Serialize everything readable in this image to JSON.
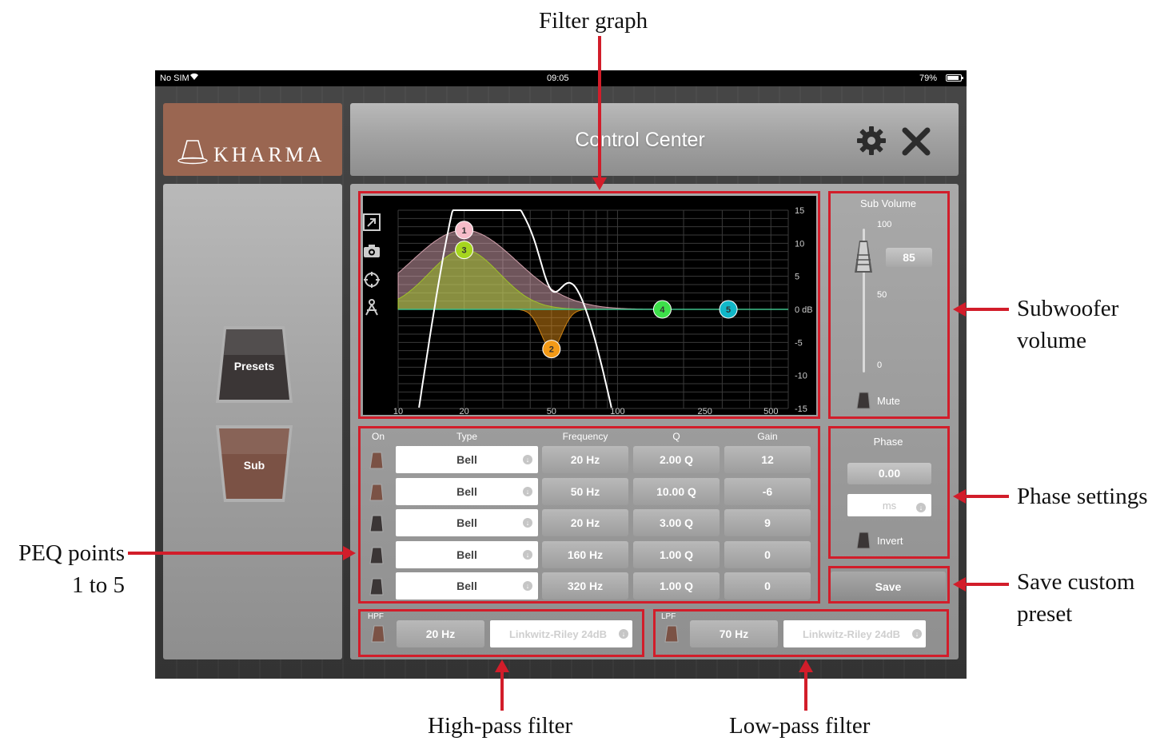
{
  "annotations": {
    "filter_graph": "Filter graph",
    "subwoofer_volume": [
      "Subwoofer",
      "volume"
    ],
    "phase_settings": "Phase settings",
    "save_custom_preset": [
      "Save custom",
      "preset"
    ],
    "peq_points": [
      "PEQ points",
      "1 to 5"
    ],
    "high_pass": "High-pass filter",
    "low_pass": "Low-pass filter",
    "color": "#d21d2a"
  },
  "status_bar": {
    "carrier": "No SIM",
    "time": "09:05",
    "battery": "79%"
  },
  "logo": {
    "text": "KHARMA",
    "color": "#9a6651"
  },
  "header": {
    "title": "Control Center",
    "settings_icon": "gear-icon",
    "close_icon": "close-icon"
  },
  "sidebar": {
    "items": [
      {
        "label": "Presets",
        "color": "#3b3636"
      },
      {
        "label": "Sub",
        "color": "#7b5245"
      }
    ]
  },
  "graph": {
    "tools": [
      "expand-icon",
      "camera-icon",
      "crosshair-icon",
      "compass-icon"
    ],
    "x_ticks": [
      "10",
      "20",
      "50",
      "100",
      "250",
      "500"
    ],
    "y_ticks": [
      "15",
      "10",
      "5",
      "0 dB",
      "-5",
      "-10",
      "-15"
    ],
    "xlim": [
      10,
      600
    ],
    "ylim": [
      -15,
      15
    ],
    "points": [
      {
        "label": "1",
        "freq": 20,
        "gain": 12,
        "q": 2,
        "color": "#f6bcc9"
      },
      {
        "label": "2",
        "freq": 50,
        "gain": -6,
        "q": 10,
        "color": "#f39a17"
      },
      {
        "label": "3",
        "freq": 20,
        "gain": 9,
        "q": 3,
        "color": "#a6d51e"
      },
      {
        "label": "4",
        "freq": 160,
        "gain": 0,
        "q": 1,
        "color": "#3de04a"
      },
      {
        "label": "5",
        "freq": 320,
        "gain": 0,
        "q": 1,
        "color": "#10b7c8"
      }
    ],
    "response_color": "#ffffff",
    "grid_color": "#3a3a3a"
  },
  "volume": {
    "title": "Sub Volume",
    "max": "100",
    "mid": "50",
    "min": "0",
    "value": "85",
    "level": 85,
    "mute_label": "Mute"
  },
  "peq": {
    "headers": [
      "On",
      "Type",
      "Frequency",
      "Q",
      "Gain"
    ],
    "rows": [
      {
        "on": true,
        "type": "Bell",
        "freq": "20 Hz",
        "q": "2.00 Q",
        "gain": "12"
      },
      {
        "on": true,
        "type": "Bell",
        "freq": "50 Hz",
        "q": "10.00 Q",
        "gain": "-6"
      },
      {
        "on": false,
        "type": "Bell",
        "freq": "20 Hz",
        "q": "3.00 Q",
        "gain": "9"
      },
      {
        "on": false,
        "type": "Bell",
        "freq": "160 Hz",
        "q": "1.00 Q",
        "gain": "0"
      },
      {
        "on": false,
        "type": "Bell",
        "freq": "320 Hz",
        "q": "1.00 Q",
        "gain": "0"
      }
    ]
  },
  "phase": {
    "title": "Phase",
    "value": "0.00",
    "unit": "ms",
    "invert_label": "Invert"
  },
  "save": {
    "label": "Save"
  },
  "hpf": {
    "tag": "HPF",
    "freq": "20 Hz",
    "type": "Linkwitz-Riley 24dB"
  },
  "lpf": {
    "tag": "LPF",
    "freq": "70 Hz",
    "type": "Linkwitz-Riley 24dB"
  }
}
